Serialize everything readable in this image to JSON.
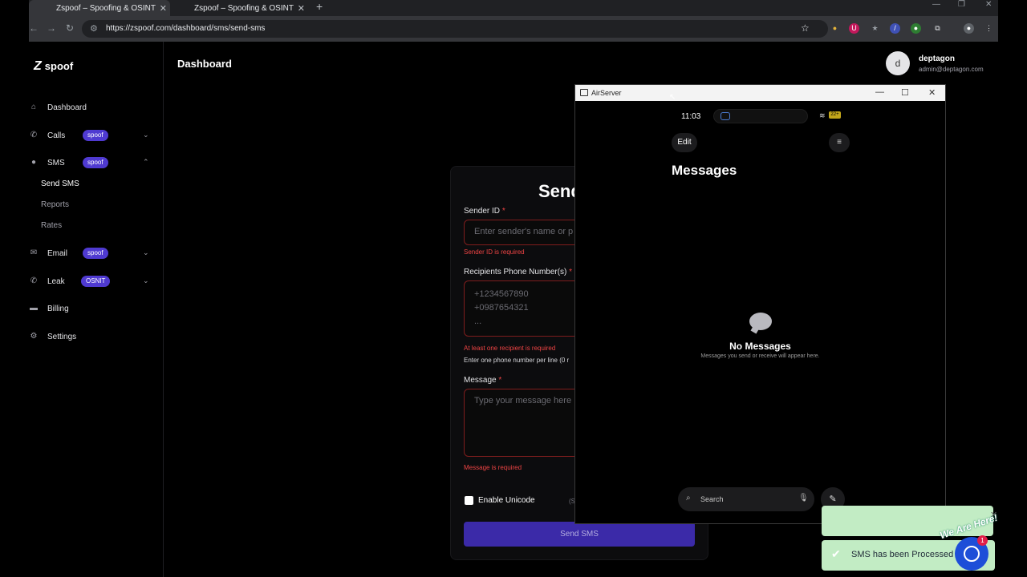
{
  "browser": {
    "tabs": [
      {
        "title": "Zspoof – Spoofing & OSINT"
      },
      {
        "title": "Zspoof – Spoofing & OSINT"
      }
    ],
    "url": "https://zspoof.com/dashboard/sms/send-sms"
  },
  "sidebar": {
    "logo": "spoof",
    "items": [
      {
        "label": "Dashboard",
        "icon": "home-icon"
      },
      {
        "label": "Calls",
        "badge": "spoof",
        "icon": "phone-icon"
      },
      {
        "label": "SMS",
        "badge": "spoof",
        "icon": "chat-icon"
      },
      {
        "label": "Email",
        "badge": "spoof",
        "icon": "mail-icon"
      },
      {
        "label": "Leak",
        "badge": "OSNIT",
        "icon": "phone-icon"
      },
      {
        "label": "Billing",
        "icon": "card-icon"
      },
      {
        "label": "Settings",
        "icon": "gear-icon"
      }
    ],
    "sms_sub": [
      "Send SMS",
      "Reports",
      "Rates"
    ]
  },
  "header": {
    "title": "Dashboard",
    "user_initial": "d",
    "user_name": "deptagon",
    "user_email": "admin@deptagon.com"
  },
  "form": {
    "title": "Send",
    "sender_label": "Sender ID",
    "sender_placeholder": "Enter sender's name or p",
    "sender_error": "Sender ID is required",
    "recipients_label": "Recipients Phone Number(s)",
    "recipients_placeholder": [
      "+1234567890",
      "+0987654321",
      "..."
    ],
    "recipients_error": "At least one recipient is required",
    "recipients_hint": "Enter one phone number per line (0 r",
    "message_label": "Message",
    "message_placeholder": "Type your message here",
    "message_error": "Message is required",
    "unicode_label": "Enable Unicode",
    "unicode_note": "(S",
    "submit": "Send SMS",
    "required_mark": "*"
  },
  "airserver": {
    "title": "AirServer",
    "time": "11:03",
    "battery": "22+",
    "edit": "Edit",
    "heading": "Messages",
    "empty_title": "No Messages",
    "empty_sub": "Messages you send or receive will appear here.",
    "search": "Search"
  },
  "toast": {
    "text": "SMS has been Processed"
  },
  "chat": {
    "tagline": "We Are Here!",
    "badge": "1"
  }
}
